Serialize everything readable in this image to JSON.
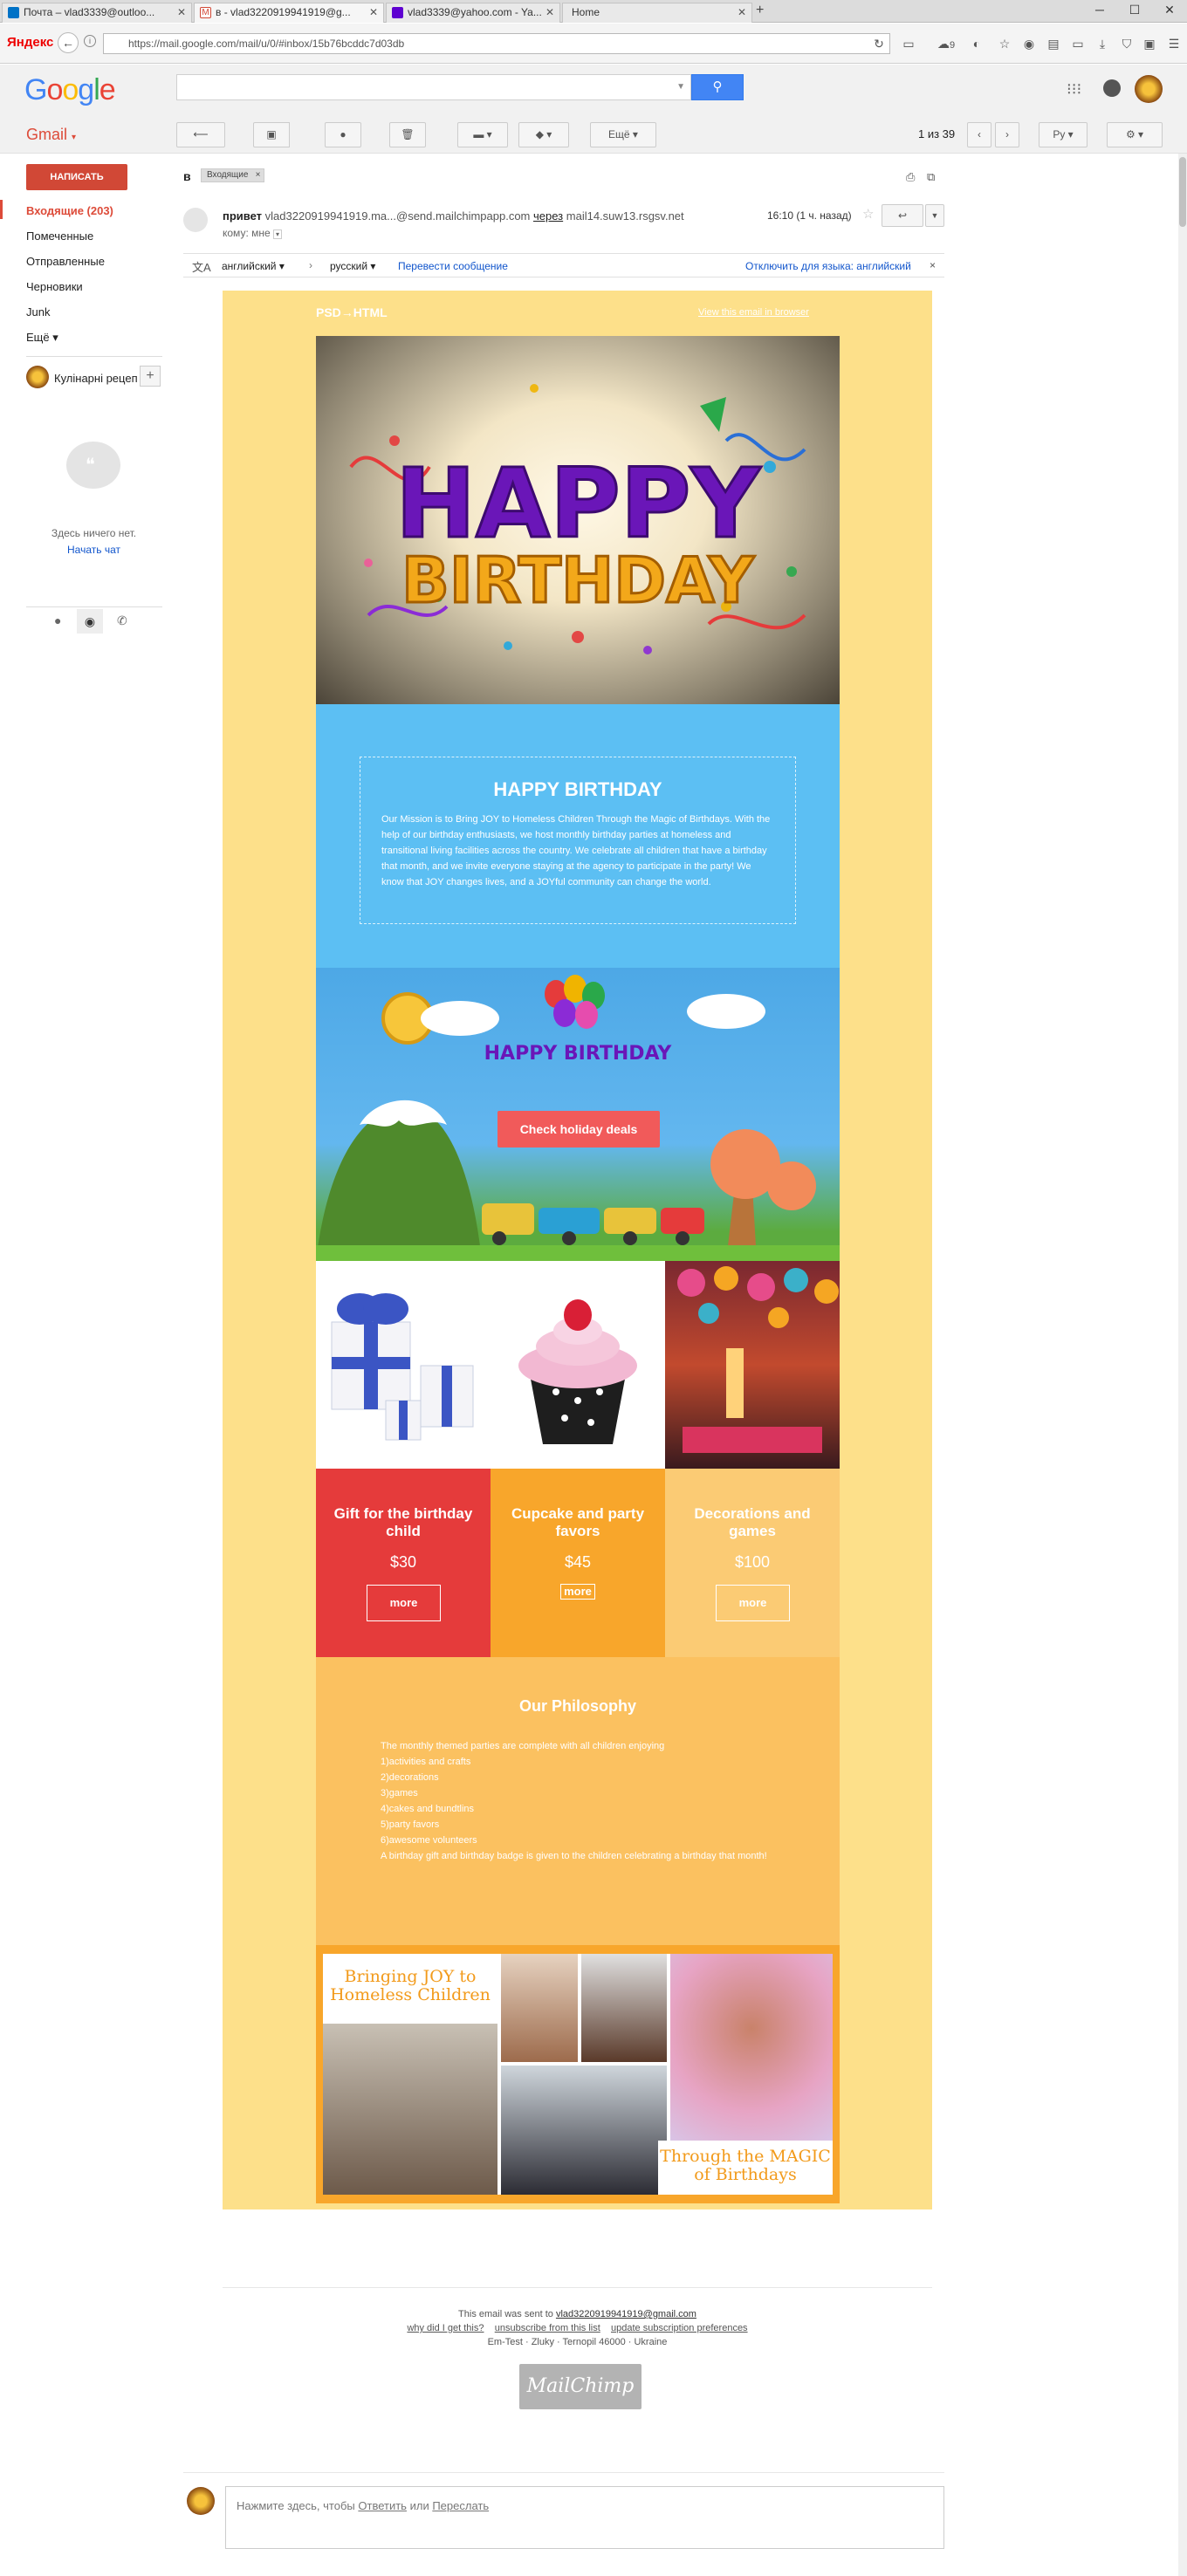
{
  "browser": {
    "tabs": [
      {
        "label": "Почта – vlad3339@outloo..."
      },
      {
        "label": "в - vlad3220919941919@g..."
      },
      {
        "label": "vlad3339@yahoo.com - Ya..."
      },
      {
        "label": "Home"
      }
    ],
    "brand": "Яндекс",
    "url": "https://mail.google.com/mail/u/0/#inbox/15b76bcddc7d03db",
    "weather": "9"
  },
  "google": {
    "logo": "Google",
    "app": "Gmail"
  },
  "toolbar": {
    "more_label": "Ещё",
    "pager": "1 из 39",
    "lang_btn": "Ру"
  },
  "sidebar": {
    "compose": "НАПИСАТЬ",
    "items": [
      {
        "label": "Входящие (203)"
      },
      {
        "label": "Помеченные"
      },
      {
        "label": "Отправленные"
      },
      {
        "label": "Черновики"
      },
      {
        "label": "Junk"
      },
      {
        "label": "Ещё"
      }
    ],
    "hangout_user": "Кулінарні рецеп",
    "chat_empty": "Здесь ничего нет.",
    "chat_start": "Начать чат"
  },
  "message": {
    "subject": "в",
    "label_chip": "Входящие",
    "sender_name": "привет",
    "sender_email": "vlad3220919941919.ma...@send.mailchimpapp.com",
    "via_word": "через",
    "via_domain": "mail14.suw13.rsgsv.net",
    "time": "16:10 (1 ч. назад)",
    "to_line": "кому: мне",
    "translate_from": "английский",
    "translate_to": "русский",
    "translate_action": "Перевести сообщение",
    "translate_disable": "Отключить для языка: английский"
  },
  "email": {
    "brand": "PSD→HTML",
    "view_browser": "View this email in browser",
    "hero_title": "HAPPY BIRTHDAY",
    "mission_text": "Our Mission is to Bring JOY to Homeless Children Through the Magic of Birthdays. With the help of our birthday enthusiasts, we host monthly birthday parties at homeless and transitional living facilities across the country. We celebrate all children that have a birthday that month, and we invite everyone staying at the agency to participate in the party! We know that JOY changes lives, and a JOYful community can change the world.",
    "banner_art_text": "HAPPY BIRTHDAY",
    "cta": "Check holiday deals",
    "products": [
      {
        "title": "Gift for the birthday child",
        "price": "$30",
        "more": "more",
        "color": "#e53b3b"
      },
      {
        "title": "Cupcake and party favors",
        "price": "$45",
        "more": "more",
        "color": "#f8a62b"
      },
      {
        "title": "Decorations and games",
        "price": "$100",
        "more": "more",
        "color": "#fbcb74"
      }
    ],
    "philosophy_title": "Our Philosophy",
    "philosophy_lines": [
      "The monthly themed parties are complete with all children enjoying",
      "1)activities and crafts",
      "2)decorations",
      "3)games",
      "4)cakes and bundtlins",
      "5)party favors",
      "6)awesome volunteers",
      "A birthday gift and birthday badge is given to the children celebrating a birthday that month!"
    ],
    "collage_top": "Bringing JOY to Homeless Children",
    "collage_bottom": "Through the MAGIC of Birthdays",
    "footer_sent": "This email was sent to",
    "footer_email": "vlad3220919941919@gmail.com",
    "footer_why": "why did I get this?",
    "footer_unsub": "unsubscribe from this list",
    "footer_update": "update subscription preferences",
    "footer_address": "Em-Test · Zluky · Ternopil 46000 · Ukraine",
    "mailchimp": "MailChimp"
  },
  "reply": {
    "prompt": "Нажмите здесь, чтобы",
    "reply_link": "Ответить",
    "or": "или",
    "forward_link": "Переслать"
  },
  "colors": {
    "email_bg": "#fde08a",
    "sky": "#5cbff3",
    "cta": "#f15a5a",
    "philosophy": "#fbc160",
    "gmail_red": "#d14836"
  }
}
